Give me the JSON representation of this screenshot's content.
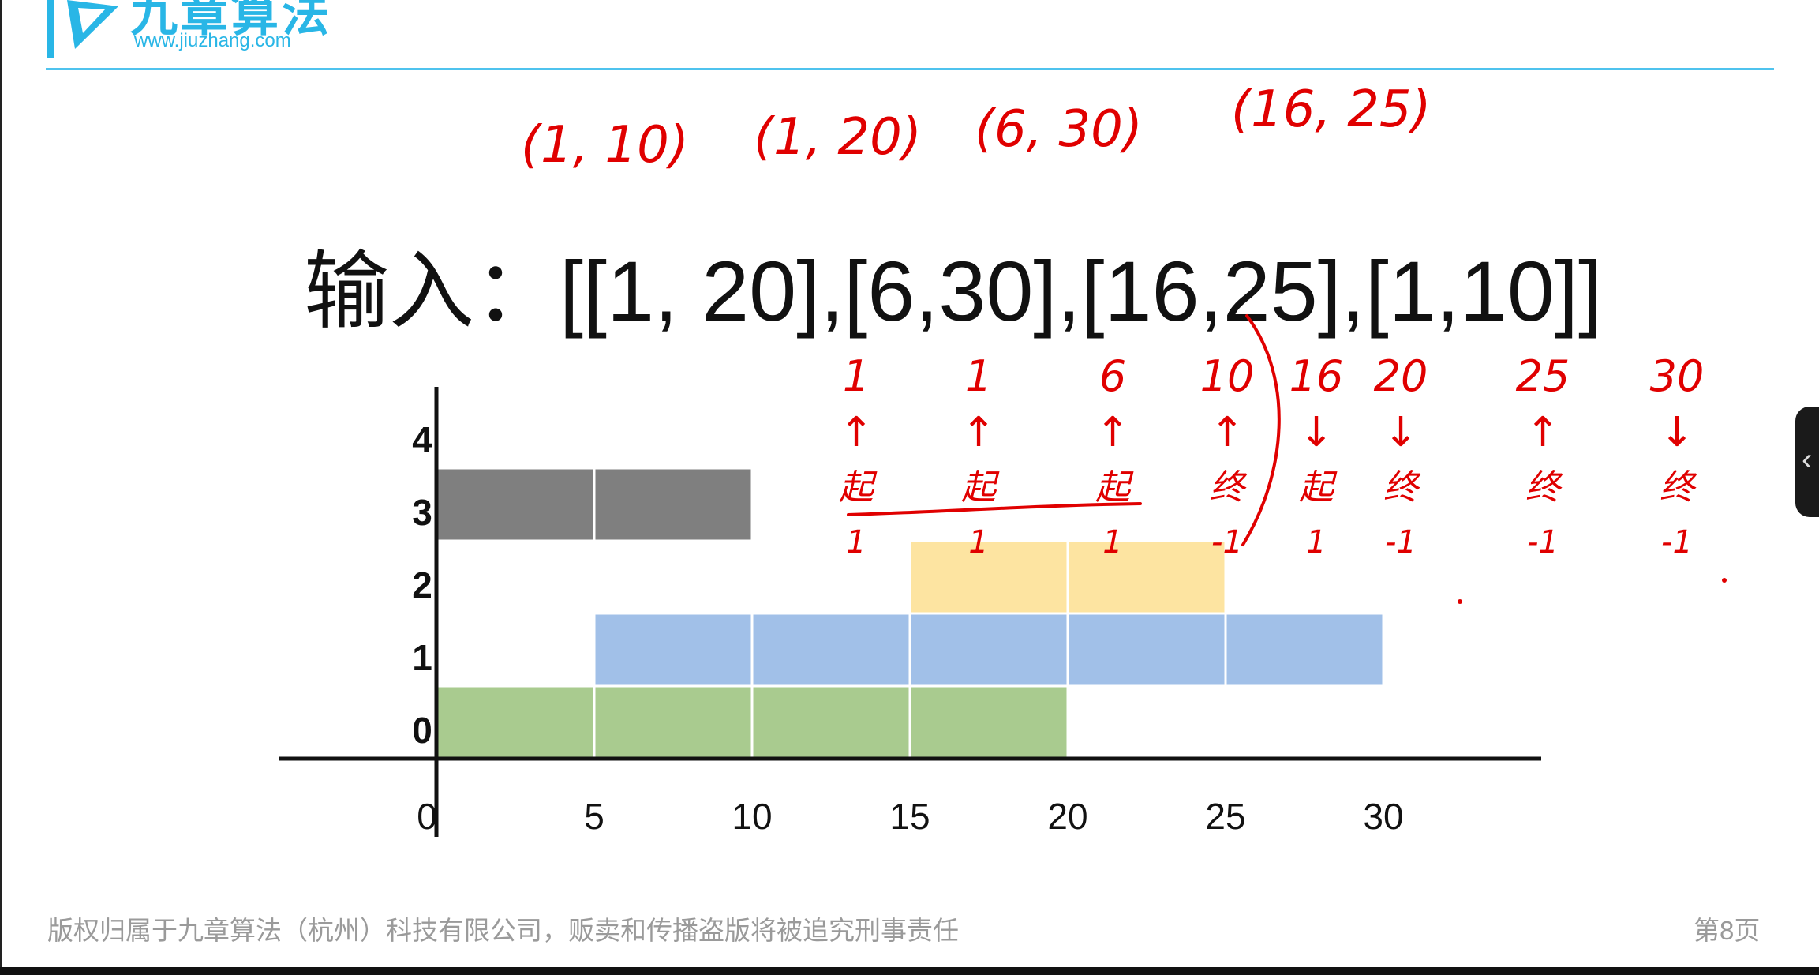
{
  "header": {
    "brand_cn": "九章算法",
    "brand_url": "www.jiuzhang.com",
    "accent": "#29b6e6"
  },
  "slide": {
    "title": "输入：[[1, 20],[6,30],[16,25],[1,10]]"
  },
  "chart_data": {
    "type": "bar",
    "x_ticks": [
      "0",
      "5",
      "10",
      "15",
      "20",
      "25",
      "30"
    ],
    "y_ticks": [
      "0",
      "1",
      "2",
      "3",
      "4"
    ],
    "xlim": [
      0,
      35
    ],
    "ylim": [
      0,
      4
    ],
    "grid": false,
    "segments": [
      {
        "row": 0,
        "start": 0,
        "end": 20,
        "color": "#a9cb8f"
      },
      {
        "row": 1,
        "start": 5,
        "end": 30,
        "color": "#a1c0e8"
      },
      {
        "row": 2,
        "start": 15,
        "end": 25,
        "color": "#fde4a1"
      },
      {
        "row": 3,
        "start": 0,
        "end": 10,
        "color": "#7f7f7f"
      }
    ]
  },
  "annotations": {
    "pairs": [
      "(1, 10)",
      "(1, 20)",
      "(6, 30)",
      "(16, 25)"
    ],
    "events": [
      {
        "value": "1",
        "arrow": "↑",
        "kind": "起",
        "delta": "1"
      },
      {
        "value": "1",
        "arrow": "↑",
        "kind": "起",
        "delta": "1"
      },
      {
        "value": "6",
        "arrow": "↑",
        "kind": "起",
        "delta": "1"
      },
      {
        "value": "10",
        "arrow": "↑",
        "kind": "终",
        "delta": "-1"
      },
      {
        "value": "16",
        "arrow": "↓",
        "kind": "起",
        "delta": "1"
      },
      {
        "value": "20",
        "arrow": "↓",
        "kind": "终",
        "delta": "-1"
      },
      {
        "value": "25",
        "arrow": "↑",
        "kind": "终",
        "delta": "-1"
      },
      {
        "value": "30",
        "arrow": "↓",
        "kind": "终",
        "delta": "-1"
      }
    ]
  },
  "footer": {
    "copyright": "版权归属于九章算法（杭州）科技有限公司，贩卖和传播盗版将被追究刑事责任",
    "page": "第8页"
  },
  "side_panel": {
    "toggle_glyph": "‹"
  }
}
